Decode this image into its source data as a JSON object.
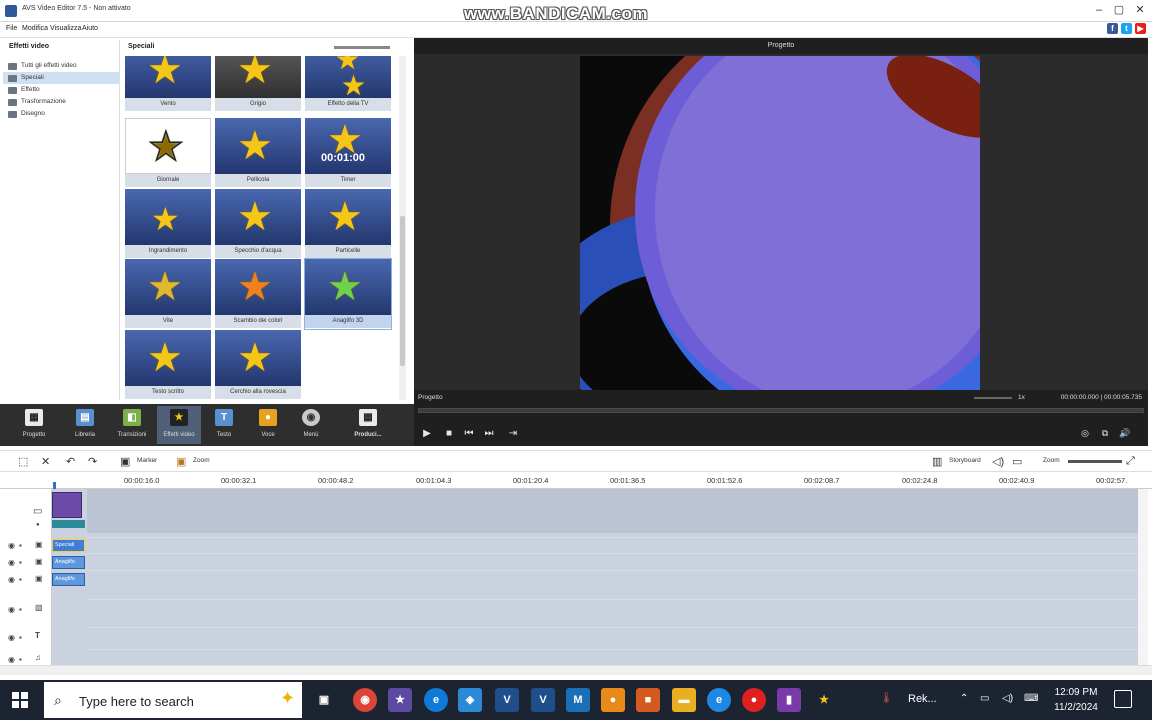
{
  "window": {
    "title": "AVS Video Editor 7.5 - Non attivato",
    "watermark": "www.BANDICAM.com",
    "menu": [
      "File",
      "Modifica",
      "Visualizza",
      "Aiuto"
    ]
  },
  "tree_panel": {
    "title": "Effetti video",
    "items": [
      {
        "label": "Tutti gli effetti video"
      },
      {
        "label": "Speciali",
        "selected": true
      },
      {
        "label": "Effetto"
      },
      {
        "label": "Trasformazione"
      },
      {
        "label": "Disegno"
      }
    ]
  },
  "grid_panel": {
    "title": "Speciali",
    "thumbnails": [
      {
        "caption": "Vento"
      },
      {
        "caption": "Grigio"
      },
      {
        "caption": "Effetto della TV"
      },
      {
        "caption": "Giornale"
      },
      {
        "caption": "Pellicola"
      },
      {
        "caption": "Timer",
        "overlay": "00:01:00"
      },
      {
        "caption": "Ingrandimento"
      },
      {
        "caption": "Specchio d'acqua"
      },
      {
        "caption": "Particelle"
      },
      {
        "caption": "Vite"
      },
      {
        "caption": "Scambio dei colori"
      },
      {
        "caption": "Anaglifo 3D",
        "selected": true
      },
      {
        "caption": "Testo scritto"
      },
      {
        "caption": "Cerchio alla rovescia"
      }
    ]
  },
  "preview": {
    "header": "Progetto",
    "label": "Progetto",
    "speed": "1x",
    "timecode": "00:00:00.000 | 00:00:05.735"
  },
  "toolbar": {
    "buttons": [
      {
        "label": "Progetto",
        "icon": "clapper-icon"
      },
      {
        "label": "Libreria",
        "icon": "film-icon"
      },
      {
        "label": "Transizioni",
        "icon": "transition-icon"
      },
      {
        "label": "Effetti video",
        "icon": "effects-icon",
        "active": true
      },
      {
        "label": "Testo",
        "icon": "text-icon",
        "glyph": "T"
      },
      {
        "label": "Voce",
        "icon": "microphone-icon"
      },
      {
        "label": "Menù",
        "icon": "disc-icon"
      },
      {
        "label": "Produci...",
        "icon": "produce-icon"
      }
    ]
  },
  "timeline_toolbar": {
    "marker_label": "Marker",
    "zoom_tool_label": "Zoom",
    "view_label": "Storyboard",
    "zoom_label": "Zoom"
  },
  "ruler": {
    "ticks": [
      "00:00:16.0",
      "00:00:32.1",
      "00:00:48.2",
      "00:01:04.3",
      "00:01:20.4",
      "00:01:36.5",
      "00:01:52.6",
      "00:02:08.7",
      "00:02:24.8",
      "00:02:40.9",
      "00:02:57."
    ]
  },
  "clips": {
    "fx": [
      "Speciali",
      "Anaglifo",
      "Anaglifo"
    ]
  },
  "taskbar": {
    "search_placeholder": "Type here to search",
    "weather_text": "Rek...",
    "time": "12:09 PM",
    "date": "11/2/2024"
  },
  "colors": {
    "accent": "#4f5f78",
    "track_bg": "#c9d2de",
    "clip_video": "#6b4aa8",
    "clip_fx": "#5d97dc",
    "star": "#f5c518",
    "taskbar": "#1c2431"
  }
}
